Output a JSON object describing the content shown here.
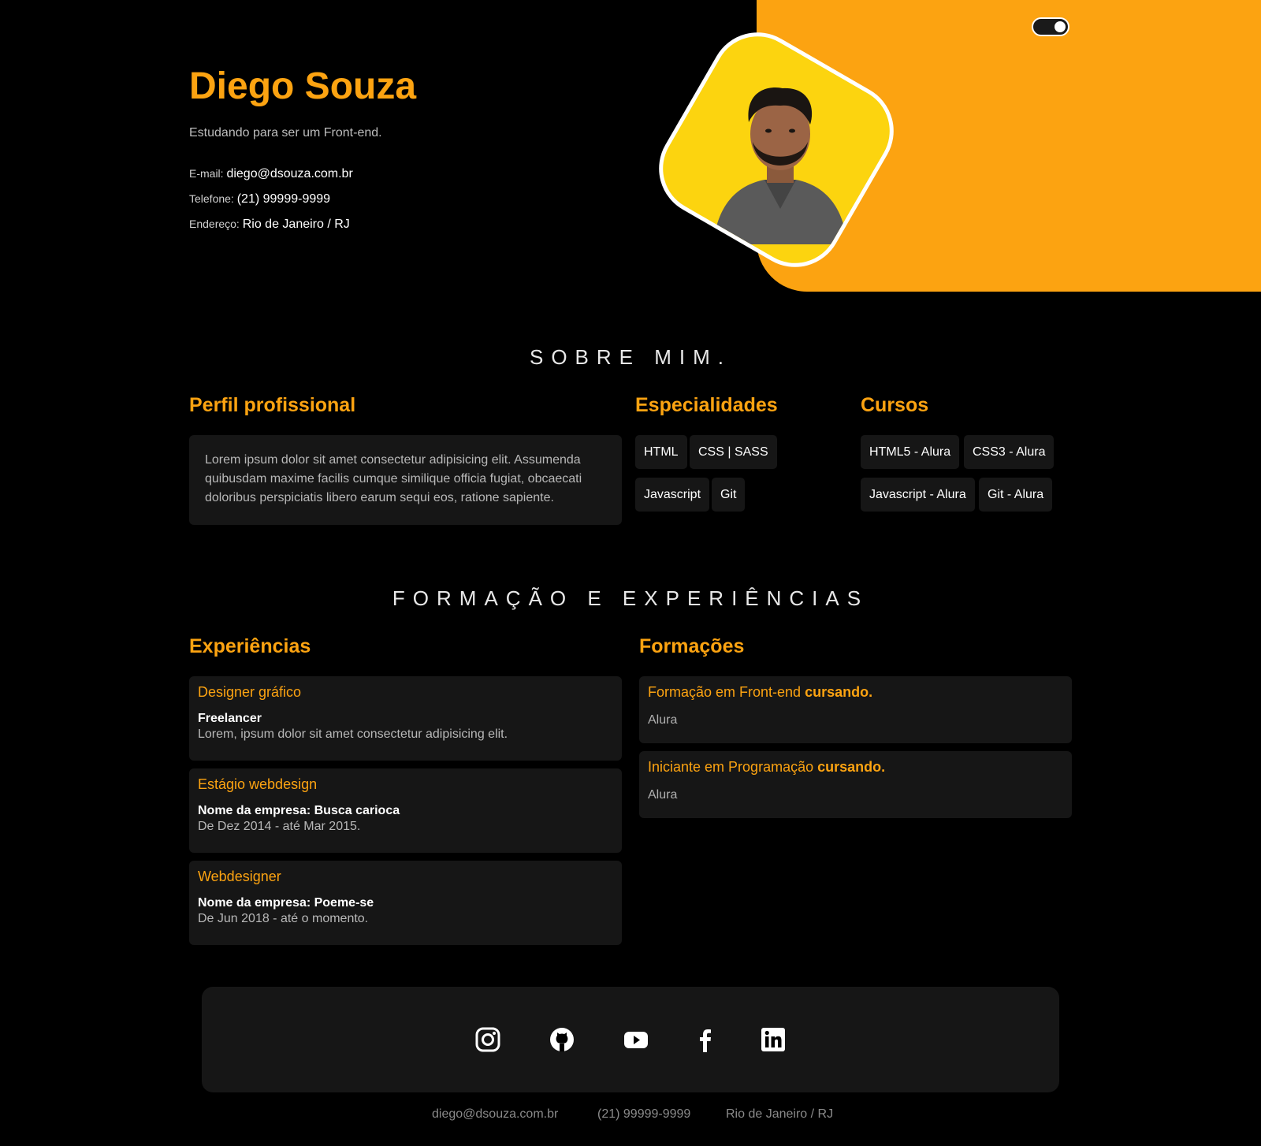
{
  "header": {
    "name": "Diego Souza",
    "tagline": "Estudando para ser um Front-end.",
    "contacts": [
      {
        "label": "E-mail:",
        "value": "diego@dsouza.com.br"
      },
      {
        "label": "Telefone:",
        "value": "(21) 99999-9999"
      },
      {
        "label": "Endereço:",
        "value": "Rio de Janeiro / RJ"
      }
    ],
    "theme_toggle": "dark-mode-toggle"
  },
  "about": {
    "title": "SOBRE MIM.",
    "perfil_heading": "Perfil profissional",
    "perfil_text": "Lorem ipsum dolor sit amet consectetur adipisicing elit. Assumenda quibusdam maxime facilis cumque similique officia fugiat, obcaecati doloribus perspiciatis libero earum sequi eos, ratione sapiente.",
    "especialidades_heading": "Especialidades",
    "especialidades": [
      "HTML",
      "CSS | SASS",
      "Javascript",
      "Git"
    ],
    "cursos_heading": "Cursos",
    "cursos": [
      "HTML5 - Alura",
      "CSS3 - Alura",
      "Javascript - Alura",
      "Git - Alura"
    ]
  },
  "experience": {
    "title": "FORMAÇÃO E EXPERIÊNCIAS",
    "exp_heading": "Experiências",
    "items": [
      {
        "role": "Designer gráfico",
        "company": "Freelancer",
        "desc": "Lorem, ipsum dolor sit amet consectetur adipisicing elit."
      },
      {
        "role": "Estágio webdesign",
        "company": "Nome da empresa: Busca carioca",
        "desc": "De Dez 2014 - até Mar 2015."
      },
      {
        "role": "Webdesigner",
        "company": "Nome da empresa: Poeme-se",
        "desc": "De Jun 2018 - até o momento."
      }
    ],
    "form_heading": "Formações",
    "formations": [
      {
        "course": "Formação em Front-end",
        "status": "cursando.",
        "school": "Alura"
      },
      {
        "course": "Iniciante em Programação",
        "status": "cursando.",
        "school": "Alura"
      }
    ]
  },
  "footer": {
    "social": [
      "instagram-icon",
      "github-icon",
      "youtube-icon",
      "facebook-icon",
      "linkedin-icon"
    ],
    "email": "diego@dsouza.com.br",
    "phone": "(21) 99999-9999",
    "address": "Rio de Janeiro / RJ"
  },
  "colors": {
    "accent": "#FCA311",
    "avatar_bg": "#FCD40F",
    "card": "#161616"
  }
}
